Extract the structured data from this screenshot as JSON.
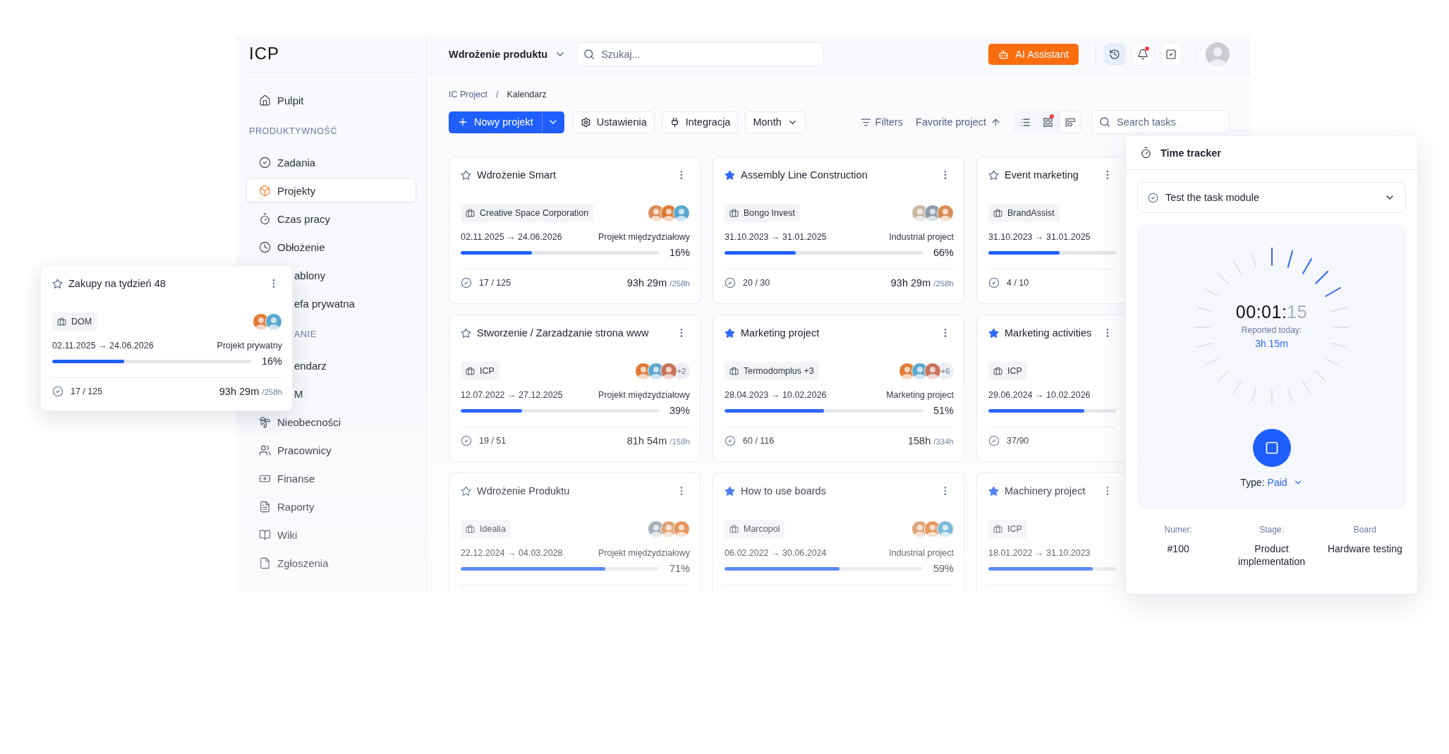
{
  "logo": "ICP",
  "sidebar": {
    "items": [
      {
        "kind": "link",
        "label": "Pulpit",
        "selected": false
      },
      {
        "kind": "heading",
        "label": "PRODUKTYWNOŚĆ"
      },
      {
        "kind": "link",
        "label": "Zadania",
        "selected": false
      },
      {
        "kind": "link",
        "label": "Projekty",
        "selected": true
      },
      {
        "kind": "link",
        "label": "Czas pracy",
        "selected": false
      },
      {
        "kind": "link",
        "label": "Obłożenie",
        "selected": false
      },
      {
        "kind": "covered_link",
        "label": "ablony"
      },
      {
        "kind": "covered_link",
        "label": "efa prywatna"
      },
      {
        "kind": "covered_heading",
        "label": "ANIE"
      },
      {
        "kind": "covered_link",
        "label": "endarz"
      },
      {
        "kind": "covered_link",
        "label": "M"
      },
      {
        "kind": "link",
        "label": "Nieobecności",
        "selected": false
      },
      {
        "kind": "link",
        "label": "Pracownicy",
        "selected": false
      },
      {
        "kind": "link",
        "label": "Finanse",
        "selected": false
      },
      {
        "kind": "link",
        "label": "Raporty",
        "selected": false
      },
      {
        "kind": "link",
        "label": "Wiki",
        "selected": false
      },
      {
        "kind": "link",
        "label": "Zgłoszenia",
        "selected": false
      }
    ]
  },
  "topbar": {
    "project": "Wdrożenie produktu",
    "search": {
      "placeholder": "Szukaj..."
    },
    "ai_button": "AI Assistant",
    "icon_buttons": [
      {
        "selected": true,
        "notification": false
      },
      {
        "selected": false,
        "notification": true
      },
      {
        "selected": false,
        "notification": false
      }
    ]
  },
  "breadcrumb": [
    "IC Project",
    "/",
    "Kalendarz"
  ],
  "toolbar": {
    "new_button": "Nowy projekt",
    "settings": "Ustawienia",
    "integration": "Integracja",
    "period": "Month",
    "filters": "Filters",
    "sort": "Favorite project",
    "view_toggles": [
      {
        "selected": false,
        "notification": false
      },
      {
        "selected": false,
        "notification": true
      },
      {
        "selected": true,
        "notification": false
      }
    ],
    "search": {
      "placeholder": "Search tasks"
    }
  },
  "cards": [
    {
      "title": "Wdrożenie Smart",
      "favorite": false,
      "client": "Creative Space Corporation",
      "avatars": [
        {
          "kind": "person"
        },
        {
          "kind": "person"
        },
        {
          "kind": "person"
        }
      ],
      "dates": "02.11.2025 → 24.06.2026",
      "type": "Projekt międzydziałowy",
      "level": 0.36,
      "percent": "16%",
      "tasks": "17 / 125",
      "time": "93h 29m",
      "time_total": "/258h"
    },
    {
      "title": "Assembly Line Construction",
      "favorite": true,
      "client": "Bongo Invest",
      "avatars": [
        {
          "kind": "person"
        },
        {
          "kind": "person"
        },
        {
          "kind": "person"
        }
      ],
      "dates": "31.10.2023 → 31.01.2025",
      "type": "Industrial project",
      "level": 0.36,
      "percent": "66%",
      "tasks": "20 / 30",
      "time": "93h 29m",
      "time_total": "/258h"
    },
    {
      "title": "Event marketing",
      "favorite": false,
      "client": "BrandAssist",
      "dates": "31.10.2023 → 31.01.2025",
      "level": 0.56,
      "tasks": "4 / 10"
    },
    {
      "title": "Stworzenie / Zarzadzanie strona www",
      "favorite": false,
      "client": "ICP",
      "avatars": [
        {
          "kind": "person"
        },
        {
          "kind": "person"
        },
        {
          "kind": "person"
        }
      ],
      "avatar_extra": "+2",
      "dates": "12.07.2022 → 27.12.2025",
      "type": "Projekt międzydziałowy",
      "level": 0.31,
      "percent": "39%",
      "tasks": "19 / 51",
      "time": "81h 54m",
      "time_total": "/158h"
    },
    {
      "title": "Marketing project",
      "favorite": true,
      "client": "Termodomplus +3",
      "avatars": [
        {
          "kind": "person"
        },
        {
          "kind": "person"
        },
        {
          "kind": "person"
        }
      ],
      "avatar_extra": "+6",
      "dates": "28.04.2023 → 10.02.2026",
      "type": "Marketing project",
      "level": 0.5,
      "percent": "51%",
      "tasks": "60 / 116",
      "time": "158h",
      "time_total": "/334h"
    },
    {
      "title": "Marketing activities",
      "favorite": true,
      "client": "ICP",
      "dates": "29.06.2024 → 10.02.2026",
      "level": 0.75,
      "tasks": "37/90"
    },
    {
      "title": "Wdrożenie Produktu",
      "favorite": false,
      "client": "Idealia",
      "avatars": [
        {
          "kind": "person"
        },
        {
          "kind": "person"
        },
        {
          "kind": "person"
        }
      ],
      "dates": "22.12.2024 → 04.03.2028",
      "type": "Projekt międzydziałowy",
      "level": 0.73,
      "percent": "71%"
    },
    {
      "title": "How to use boards",
      "favorite": true,
      "client": "Marcopol",
      "avatars": [
        {
          "kind": "person"
        },
        {
          "kind": "person"
        },
        {
          "kind": "person"
        }
      ],
      "dates": "06.02.2022 → 30.06.2024",
      "type": "Industrial project",
      "level": 0.58,
      "percent": "59%"
    },
    {
      "title": "Machinery project",
      "favorite": true,
      "client": "ICP",
      "dates": "18.01.2022 → 31.10.2023",
      "level": 0.82
    }
  ],
  "floating_card": {
    "title": "Zakupy na tydzień 48",
    "favorite": false,
    "client": "DOM",
    "avatars": [
      {
        "kind": "person"
      },
      {
        "kind": "person"
      }
    ],
    "dates": "02.11.2025 → 24.06.2026",
    "type": "Projekt prywatny",
    "level": 0.36,
    "percent": "16%",
    "tasks": "17 / 125",
    "time": "93h 29m",
    "time_total": "/258h"
  },
  "time_tracker": {
    "title": "Time tracker",
    "task": "Test the task module",
    "dial": {
      "level": 0.21
    },
    "time_main": "00:01:",
    "time_seconds": "15",
    "reported_label": "Reported today:",
    "reported_value": "3h 15m",
    "type_label": "Type:",
    "type_value": "Paid",
    "details": [
      {
        "label": "Numer:",
        "value": "#100"
      },
      {
        "label": "Stage:",
        "value": "Product implementation"
      },
      {
        "label": "Board",
        "value": "Hardware testing"
      }
    ]
  }
}
